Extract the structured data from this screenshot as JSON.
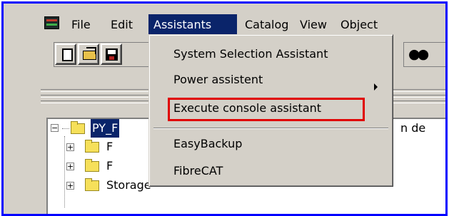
{
  "menubar": {
    "items": [
      {
        "label": "File"
      },
      {
        "label": "Edit"
      },
      {
        "label": "Assistants"
      },
      {
        "label": "Catalog"
      },
      {
        "label": "View"
      },
      {
        "label": "Object"
      }
    ],
    "active": "Assistants"
  },
  "toolbar": {
    "buttons": [
      "new-icon",
      "open-icon",
      "save-icon",
      "find-icon"
    ]
  },
  "dropdown": {
    "items": [
      {
        "label": "System Selection Assistant"
      },
      {
        "label": "Power assistent",
        "submenu": true
      },
      {
        "label": "Execute console assistant",
        "highlighted": true
      },
      {
        "label": "EasyBackup"
      },
      {
        "label": "FibreCAT"
      }
    ]
  },
  "tree": {
    "root_label": "PY_F",
    "root_suffix": "n de",
    "children": [
      {
        "label": "F"
      },
      {
        "label": "F"
      },
      {
        "label": "Storage"
      }
    ]
  },
  "colors": {
    "frame_border": "#0000ff",
    "menu_active": "#0a246a",
    "highlight_box": "#e00000"
  }
}
